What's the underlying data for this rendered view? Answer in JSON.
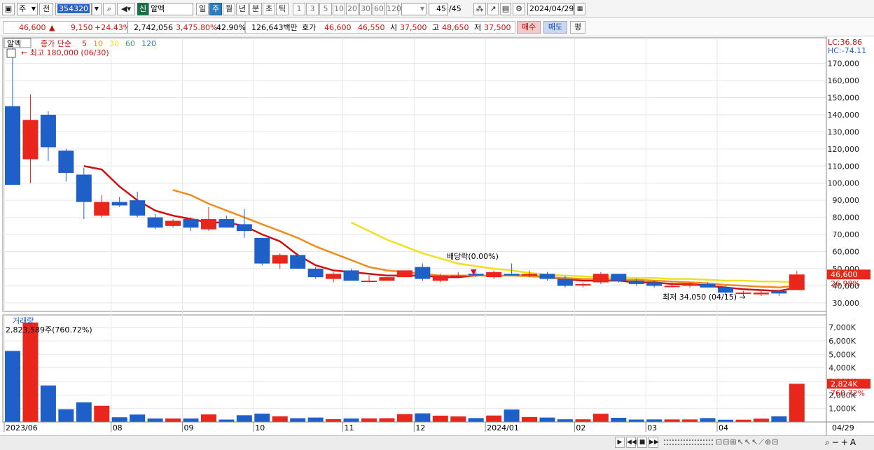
{
  "toolbar1": {
    "type_select": "주",
    "prev_label": "전",
    "code": "354320",
    "badge": "신",
    "name": "알멕",
    "periods": [
      "일",
      "주",
      "월",
      "년",
      "분",
      "초",
      "틱"
    ],
    "active_period": "주",
    "intervals": [
      "1",
      "3",
      "5",
      "10",
      "20",
      "30",
      "60",
      "120"
    ],
    "count": "45",
    "count_total": "/45",
    "date": "2024/04/29"
  },
  "toolbar2": {
    "price": "46,600",
    "change_arrow": "▲",
    "change": "9,150",
    "change_pct": "+24.43%",
    "volume": "2,742,056",
    "volume_pct": "3,475.80%",
    "turnover_pct": "42.90%",
    "amount": "126,643백만",
    "hoga_label": "호가",
    "ask": "46,600",
    "bid": "46,550",
    "open_label": "시",
    "open": "37,500",
    "high_label": "고",
    "high": "48,650",
    "low_label": "저",
    "low": "37,500",
    "buy_label": "매수",
    "sell_label": "매도",
    "eval_label": "평"
  },
  "price_panel": {
    "name_tag": "알멕",
    "ma_label": "종가 단순",
    "ma_periods": [
      "5",
      "10",
      "30",
      "60",
      "120"
    ],
    "ma_colors": [
      "#d01010",
      "#f08c1e",
      "#f0e020",
      "#3aa070",
      "#3070c0"
    ],
    "max_label": "최고 180,000 (06/30)",
    "min_label": "최저 34,050 (04/15)",
    "dividend_label": "배당락(0.00%)",
    "lc_label": "LC:36.86",
    "hc_label": "HC:-74.11",
    "current_price_tag": "46,600",
    "current_pct_tag": "26.98%",
    "y_ticks": [
      "170,000",
      "160,000",
      "150,000",
      "140,000",
      "130,000",
      "120,000",
      "110,000",
      "100,000",
      "90,000",
      "80,000",
      "70,000",
      "60,000",
      "50,000",
      "40,000",
      "30,000"
    ]
  },
  "volume_panel": {
    "title": "거래량",
    "value_label": "2,823,589주(760.72%)",
    "y_ticks": [
      "7,000K",
      "6,000K",
      "5,000K",
      "4,000K",
      "3,000K",
      "2,000K",
      "1,000K"
    ],
    "current_tag": "2,824K",
    "current_pct_tag": "760.72%"
  },
  "x_axis": {
    "labels": [
      "2023/06",
      "08",
      "09",
      "10",
      "11",
      "12",
      "2024/01",
      "02",
      "03",
      "04"
    ],
    "right_label": "04/29"
  },
  "colors": {
    "up": "#e8261c",
    "down": "#1f5fc8",
    "ma5": "#d01010",
    "ma10": "#f08c1e",
    "ma20": "#f0e020"
  },
  "chart_data": {
    "type": "candlestick",
    "candles": [
      {
        "o": 145000,
        "h": 180000,
        "l": 99000,
        "c": 99000
      },
      {
        "o": 114000,
        "h": 152000,
        "l": 100000,
        "c": 137000
      },
      {
        "o": 140000,
        "h": 142000,
        "l": 113000,
        "c": 121000
      },
      {
        "o": 119000,
        "h": 120000,
        "l": 101000,
        "c": 106000
      },
      {
        "o": 105000,
        "h": 109000,
        "l": 79000,
        "c": 89000
      },
      {
        "o": 81000,
        "h": 93000,
        "l": 80000,
        "c": 89000
      },
      {
        "o": 89000,
        "h": 92000,
        "l": 86000,
        "c": 87000
      },
      {
        "o": 90000,
        "h": 95000,
        "l": 80000,
        "c": 81000
      },
      {
        "o": 80000,
        "h": 82000,
        "l": 73000,
        "c": 74000
      },
      {
        "o": 75000,
        "h": 79000,
        "l": 74000,
        "c": 78000
      },
      {
        "o": 79000,
        "h": 80000,
        "l": 72000,
        "c": 74000
      },
      {
        "o": 73000,
        "h": 86000,
        "l": 72000,
        "c": 79000
      },
      {
        "o": 79000,
        "h": 81000,
        "l": 74000,
        "c": 74000
      },
      {
        "o": 76000,
        "h": 85000,
        "l": 68000,
        "c": 72000
      },
      {
        "o": 68000,
        "h": 68000,
        "l": 52000,
        "c": 53000
      },
      {
        "o": 53000,
        "h": 59000,
        "l": 50000,
        "c": 58000
      },
      {
        "o": 58000,
        "h": 59000,
        "l": 50000,
        "c": 50000
      },
      {
        "o": 50000,
        "h": 51000,
        "l": 44000,
        "c": 45000
      },
      {
        "o": 44000,
        "h": 48000,
        "l": 42000,
        "c": 47000
      },
      {
        "o": 49000,
        "h": 50000,
        "l": 43000,
        "c": 43000
      },
      {
        "o": 43000,
        "h": 46000,
        "l": 42000,
        "c": 43000
      },
      {
        "o": 43000,
        "h": 45000,
        "l": 43000,
        "c": 45000
      },
      {
        "o": 45000,
        "h": 49000,
        "l": 45000,
        "c": 49000
      },
      {
        "o": 51000,
        "h": 53000,
        "l": 43000,
        "c": 44000
      },
      {
        "o": 43000,
        "h": 47000,
        "l": 42000,
        "c": 46000
      },
      {
        "o": 46000,
        "h": 48000,
        "l": 45000,
        "c": 46000
      },
      {
        "o": 47000,
        "h": 48000,
        "l": 45000,
        "c": 46000
      },
      {
        "o": 45000,
        "h": 49000,
        "l": 44000,
        "c": 48000
      },
      {
        "o": 47000,
        "h": 53000,
        "l": 46000,
        "c": 46000
      },
      {
        "o": 46000,
        "h": 49000,
        "l": 45000,
        "c": 47000
      },
      {
        "o": 47000,
        "h": 48000,
        "l": 43000,
        "c": 44000
      },
      {
        "o": 44000,
        "h": 46000,
        "l": 39000,
        "c": 40000
      },
      {
        "o": 41000,
        "h": 42000,
        "l": 39000,
        "c": 41000
      },
      {
        "o": 42000,
        "h": 48000,
        "l": 41000,
        "c": 47000
      },
      {
        "o": 47000,
        "h": 47000,
        "l": 42000,
        "c": 43000
      },
      {
        "o": 43000,
        "h": 44000,
        "l": 40000,
        "c": 41000
      },
      {
        "o": 42000,
        "h": 43000,
        "l": 39000,
        "c": 40000
      },
      {
        "o": 40000,
        "h": 42000,
        "l": 39000,
        "c": 40000
      },
      {
        "o": 40000,
        "h": 42000,
        "l": 39000,
        "c": 41000
      },
      {
        "o": 41000,
        "h": 42000,
        "l": 39000,
        "c": 39000
      },
      {
        "o": 39000,
        "h": 40000,
        "l": 35000,
        "c": 36000
      },
      {
        "o": 36000,
        "h": 37000,
        "l": 34050,
        "c": 36000
      },
      {
        "o": 35000,
        "h": 37000,
        "l": 34000,
        "c": 36000
      },
      {
        "o": 37000,
        "h": 37000,
        "l": 34000,
        "c": 35500
      },
      {
        "o": 37500,
        "h": 48650,
        "l": 37500,
        "c": 46600
      }
    ],
    "volumes": [
      5250,
      7350,
      2700,
      940,
      1450,
      1200,
      350,
      550,
      260,
      260,
      260,
      560,
      180,
      500,
      620,
      420,
      280,
      330,
      210,
      260,
      270,
      280,
      580,
      640,
      470,
      410,
      290,
      480,
      920,
      370,
      330,
      200,
      200,
      610,
      310,
      180,
      190,
      190,
      190,
      290,
      170,
      170,
      250,
      420,
      2824
    ],
    "ma_lines": [
      {
        "name": "5",
        "points": [
          [
            4,
            110000
          ],
          [
            5,
            108000
          ],
          [
            6,
            98000
          ],
          [
            7,
            90000
          ],
          [
            8,
            84000
          ],
          [
            9,
            81000
          ],
          [
            10,
            79000
          ],
          [
            11,
            77000
          ],
          [
            12,
            77000
          ],
          [
            13,
            75000
          ],
          [
            14,
            70000
          ],
          [
            15,
            66000
          ],
          [
            16,
            58000
          ],
          [
            17,
            52000
          ],
          [
            18,
            49000
          ],
          [
            19,
            48000
          ],
          [
            20,
            47000
          ],
          [
            21,
            46000
          ],
          [
            22,
            46000
          ],
          [
            23,
            46000
          ],
          [
            24,
            45000
          ],
          [
            25,
            45000
          ],
          [
            26,
            46000
          ],
          [
            27,
            46000
          ],
          [
            28,
            46000
          ],
          [
            29,
            46000
          ],
          [
            30,
            45000
          ],
          [
            31,
            44000
          ],
          [
            32,
            43000
          ],
          [
            33,
            43000
          ],
          [
            34,
            43000
          ],
          [
            35,
            42000
          ],
          [
            36,
            42000
          ],
          [
            37,
            41000
          ],
          [
            38,
            41000
          ],
          [
            39,
            40000
          ],
          [
            40,
            39000
          ],
          [
            41,
            38000
          ],
          [
            42,
            37500
          ],
          [
            43,
            37000
          ],
          [
            44,
            39000
          ]
        ]
      },
      {
        "name": "10",
        "points": [
          [
            9,
            96000
          ],
          [
            10,
            93000
          ],
          [
            11,
            88000
          ],
          [
            12,
            84000
          ],
          [
            13,
            80000
          ],
          [
            14,
            76000
          ],
          [
            15,
            72000
          ],
          [
            16,
            68000
          ],
          [
            17,
            63000
          ],
          [
            18,
            59000
          ],
          [
            19,
            55000
          ],
          [
            20,
            51000
          ],
          [
            21,
            49000
          ],
          [
            22,
            48000
          ],
          [
            23,
            47000
          ],
          [
            24,
            46000
          ],
          [
            25,
            46000
          ],
          [
            26,
            46000
          ],
          [
            27,
            46000
          ],
          [
            28,
            46000
          ],
          [
            29,
            45500
          ],
          [
            30,
            45000
          ],
          [
            31,
            44500
          ],
          [
            32,
            44000
          ],
          [
            33,
            44000
          ],
          [
            34,
            43500
          ],
          [
            35,
            43500
          ],
          [
            36,
            43000
          ],
          [
            37,
            42500
          ],
          [
            38,
            42000
          ],
          [
            39,
            41500
          ],
          [
            40,
            40500
          ],
          [
            41,
            40000
          ],
          [
            42,
            39500
          ],
          [
            43,
            39000
          ],
          [
            44,
            40000
          ]
        ]
      },
      {
        "name": "30",
        "points": [
          [
            19,
            77000
          ],
          [
            20,
            72000
          ],
          [
            21,
            67000
          ],
          [
            22,
            63000
          ],
          [
            23,
            59000
          ],
          [
            24,
            56000
          ],
          [
            25,
            53000
          ],
          [
            26,
            51500
          ],
          [
            27,
            50000
          ],
          [
            28,
            49000
          ],
          [
            29,
            47500
          ],
          [
            30,
            46500
          ],
          [
            31,
            46000
          ],
          [
            32,
            45500
          ],
          [
            33,
            45000
          ],
          [
            34,
            45000
          ],
          [
            35,
            44500
          ],
          [
            36,
            44500
          ],
          [
            37,
            44000
          ],
          [
            38,
            44000
          ],
          [
            39,
            43500
          ],
          [
            40,
            43000
          ],
          [
            41,
            43000
          ],
          [
            42,
            42500
          ],
          [
            43,
            42500
          ],
          [
            44,
            42000
          ]
        ]
      }
    ],
    "price_range": [
      25000,
      185000
    ],
    "volume_range": [
      0,
      7600
    ]
  }
}
